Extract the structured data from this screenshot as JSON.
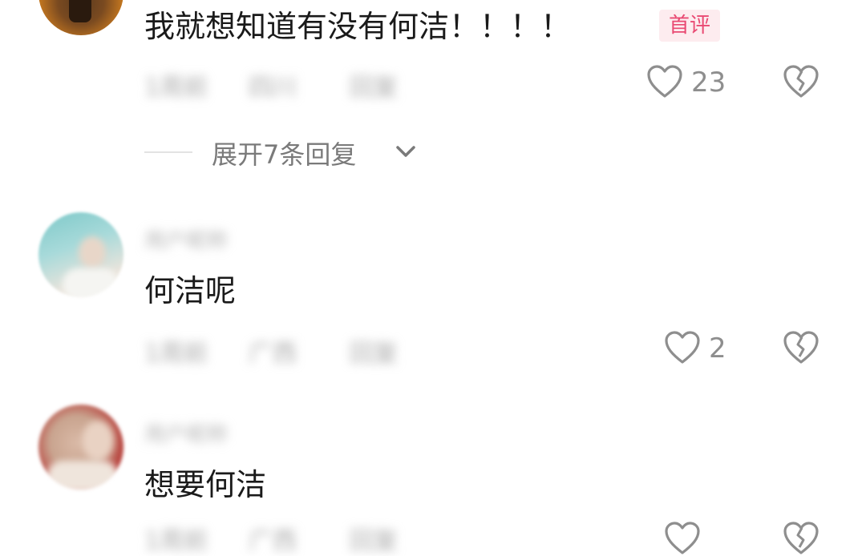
{
  "comments": [
    {
      "text": "我就想知道有没有何洁！！！！",
      "badge": "首评",
      "likes": "23",
      "meta": [
        "1周前",
        "四川",
        "回复"
      ],
      "expand_label": "展开7条回复"
    },
    {
      "username": "用户昵称",
      "text": "何洁呢",
      "likes": "2",
      "meta": [
        "1周前",
        "广西",
        "回复"
      ]
    },
    {
      "username": "用户昵称",
      "text": "想要何洁",
      "likes": "",
      "meta": [
        "1周前",
        "广西",
        "回复"
      ]
    }
  ]
}
